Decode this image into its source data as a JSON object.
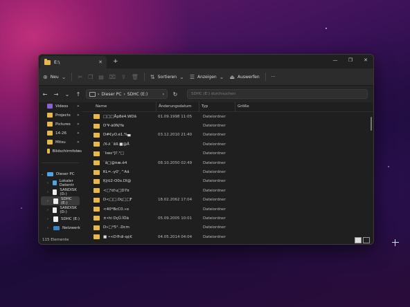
{
  "window": {
    "tab_title": "E:\\",
    "new_tab": "+",
    "controls": [
      "—",
      "❐",
      "✕"
    ]
  },
  "toolbar": {
    "new_label": "Neu",
    "sort_label": "Sortieren",
    "view_label": "Anzeigen",
    "eject_label": "Auswerfen",
    "more_label": "···"
  },
  "address": {
    "crumbs": [
      "Dieser PC",
      "SDHC (E:)"
    ],
    "search_placeholder": "SDHC (E:) durchsuchen"
  },
  "sidebar": {
    "pinned": [
      {
        "label": "Videos",
        "color": "#8a63d2"
      },
      {
        "label": "Projects",
        "color": "#e8b94a"
      },
      {
        "label": "Pictures",
        "color": "#e8b94a"
      },
      {
        "label": "14-26",
        "color": "#e8b94a"
      },
      {
        "label": "Mitsu",
        "color": "#e8b94a"
      },
      {
        "label": "Bildschirmfotos",
        "color": "#e8b94a"
      }
    ],
    "tree": [
      {
        "label": "Dieser PC",
        "type": "pc",
        "expanded": true
      },
      {
        "label": "Lokaler Datentr",
        "type": "win"
      },
      {
        "label": "SANDISK (D:)",
        "type": "drive"
      },
      {
        "label": "SDHC (E:)",
        "type": "drive",
        "selected": true
      },
      {
        "label": "SANDISK (D:)",
        "type": "drive"
      },
      {
        "label": "SDHC (E:)",
        "type": "drive"
      },
      {
        "label": "Netzwerk",
        "type": "net"
      }
    ]
  },
  "columns": {
    "name": "Name",
    "date": "Änderungsdatum",
    "type": "Typ",
    "size": "Größe"
  },
  "files": [
    {
      "name": "□□□Åp8é4.WDâ",
      "date": "01.09.1998 11:05",
      "type": "Dateiordner"
    },
    {
      "name": "D'¥-à0N/Ya",
      "date": "",
      "type": "Dateiordner"
    },
    {
      "name": "D#€yO.é1.%▄",
      "date": "03.12.2010 21:40",
      "type": "Dateiordner"
    },
    {
      "name": "/X-∂ `â9.■@Ä",
      "date": "",
      "type": "Dateiordner"
    },
    {
      "name": "ˆlıwε¹[I'.²□",
      "date": "",
      "type": "Dateiordner"
    },
    {
      "name": "`â□@¤æ.ê4",
      "date": "08.10.2050 02:49",
      "type": "Dateiordner"
    },
    {
      "name": "₭L=.-y0'¸^Áä",
      "date": "",
      "type": "Dateiordner"
    },
    {
      "name": "Ķÿû2-Ô0x.DI@",
      "date": "",
      "type": "Dateiordner"
    },
    {
      "name": "<□²d!u□D7¤",
      "date": "",
      "type": "Dateiordner"
    },
    {
      "name": "D<□□.Dç□□F",
      "date": "18.02.2062 17:04",
      "type": "Dateiordner"
    },
    {
      "name": "<40*BcC0.»o",
      "date": "",
      "type": "Dateiordner"
    },
    {
      "name": "±•hi DçÛ.ÍÒä",
      "date": "05.09.2005 10:01",
      "type": "Dateiordner"
    },
    {
      "name": "D»□*5°..Dcm",
      "date": "",
      "type": "Dateiordner"
    },
    {
      "name": "■ •<D®di-q¢€",
      "date": "04.05.2014 04:04",
      "type": "Dateiordner"
    }
  ],
  "status": {
    "count": "115 Elemente"
  }
}
